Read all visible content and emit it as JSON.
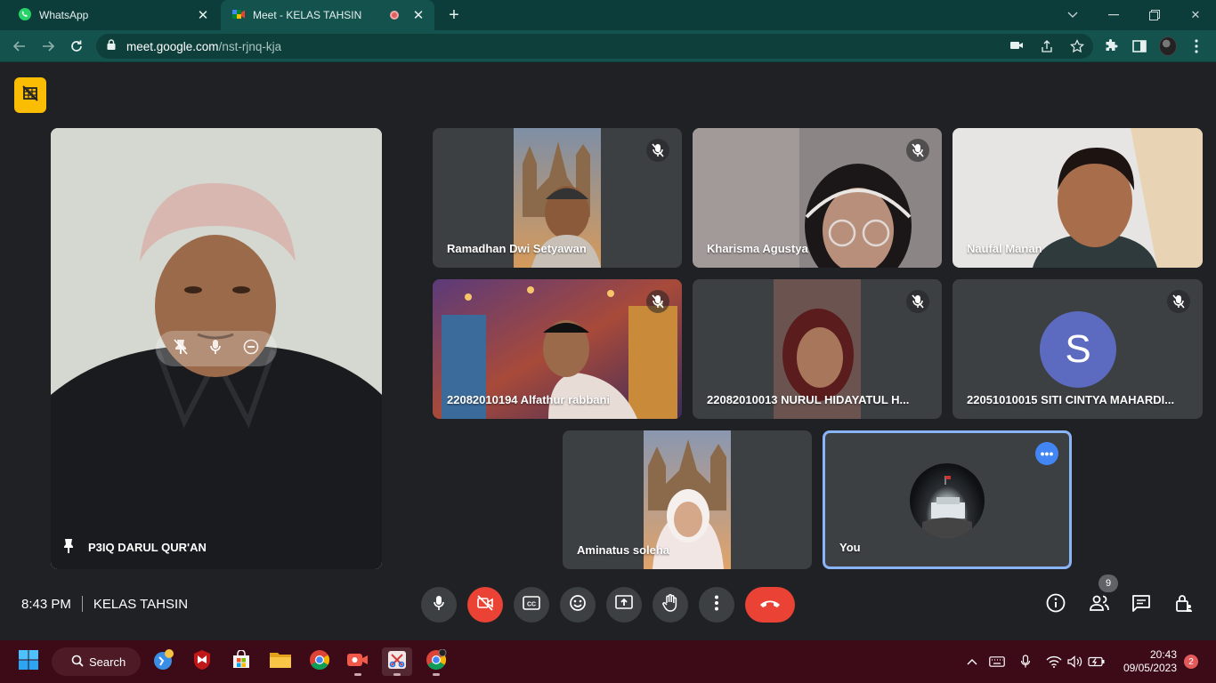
{
  "browser": {
    "tabs": [
      {
        "title": "WhatsApp",
        "icon": "whatsapp-icon",
        "active": false
      },
      {
        "title": "Meet - KELAS TAHSIN",
        "icon": "meet-icon",
        "active": true,
        "recording": true
      }
    ],
    "url_host": "meet.google.com",
    "url_path": "/nst-rjnq-kja"
  },
  "meeting": {
    "time": "8:43 PM",
    "name": "KELAS TAHSIN",
    "participant_count": "9",
    "pinned": {
      "name": "P3IQ DARUL QUR'AN"
    },
    "tiles": [
      {
        "name": "Ramadhan Dwi Setyawan",
        "muted": true
      },
      {
        "name": "Kharisma Agustya",
        "muted": true
      },
      {
        "name": "Naufal Manan",
        "muted": false
      },
      {
        "name": "22082010194 Alfathur rabbani",
        "muted": true
      },
      {
        "name": "22082010013 NURUL HIDAYATUL H...",
        "muted": true
      },
      {
        "name": "22051010015 SITI CINTYA MAHARDI...",
        "muted": true,
        "avatar_letter": "S"
      },
      {
        "name": "Aminatus soleha",
        "muted": false
      },
      {
        "name": "You",
        "muted": false
      }
    ]
  },
  "colors": {
    "accent_blue": "#8ab4f8",
    "danger_red": "#ea4335",
    "warning_yellow": "#fbbc04",
    "avatar_indigo": "#5c6bc0"
  },
  "taskbar": {
    "search_label": "Search",
    "time": "20:43",
    "date": "09/05/2023",
    "notifications": "2"
  }
}
